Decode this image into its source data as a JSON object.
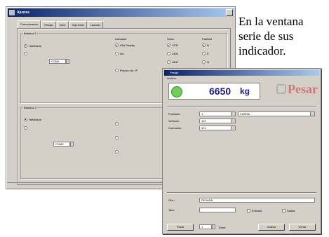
{
  "paragraph": {
    "lines": [
      "En la ventana",
      "serie de sus",
      "indicador."
    ]
  },
  "config_window": {
    "title": "Ajustes",
    "tabs": [
      "Comunicación",
      "Pesaje",
      "Visor",
      "Impresión",
      "Usuario"
    ],
    "group1": {
      "title": "Balanza 1",
      "mode_label": "Habilitada",
      "col_indicator": "Indicador",
      "col_baud": "Veloc.",
      "col_parity": "Paridad",
      "opt_indicator_a": "Alfa Display",
      "opt_indicator_b": "Iris",
      "opt_indicator_c": "Prisma Ind. IP",
      "baud": [
        "1200",
        "2400",
        "4800",
        "9600"
      ],
      "parity": [
        "N",
        "E",
        "O",
        "M"
      ],
      "port_value": "COM1"
    },
    "group2": {
      "title": "Balanza 2",
      "mode_label": "Habilitada",
      "port_value": "COM2"
    }
  },
  "weigh_window": {
    "title": "Pesaje",
    "menu": "Archivo",
    "weight_value": "6650",
    "unit": "kg",
    "logo_text": "Pesar",
    "fields": [
      {
        "label": "Producto:",
        "value": "1",
        "extra": "CARGA"
      },
      {
        "label": "Vehículo:",
        "value": "123",
        "extra": ""
      },
      {
        "label": "Conductor:",
        "value": "321",
        "extra": ""
      }
    ],
    "lower_label_1": "Obs.:",
    "lower_value_1": "PESADA",
    "lower_label_2": "Tara:",
    "check_a": "Entrada",
    "check_b": "Salida",
    "buttons": {
      "left": "Pesar",
      "mid_label": "Ticket",
      "mid_value": "1",
      "right1": "Grabar",
      "right2": "Cerrar"
    }
  }
}
